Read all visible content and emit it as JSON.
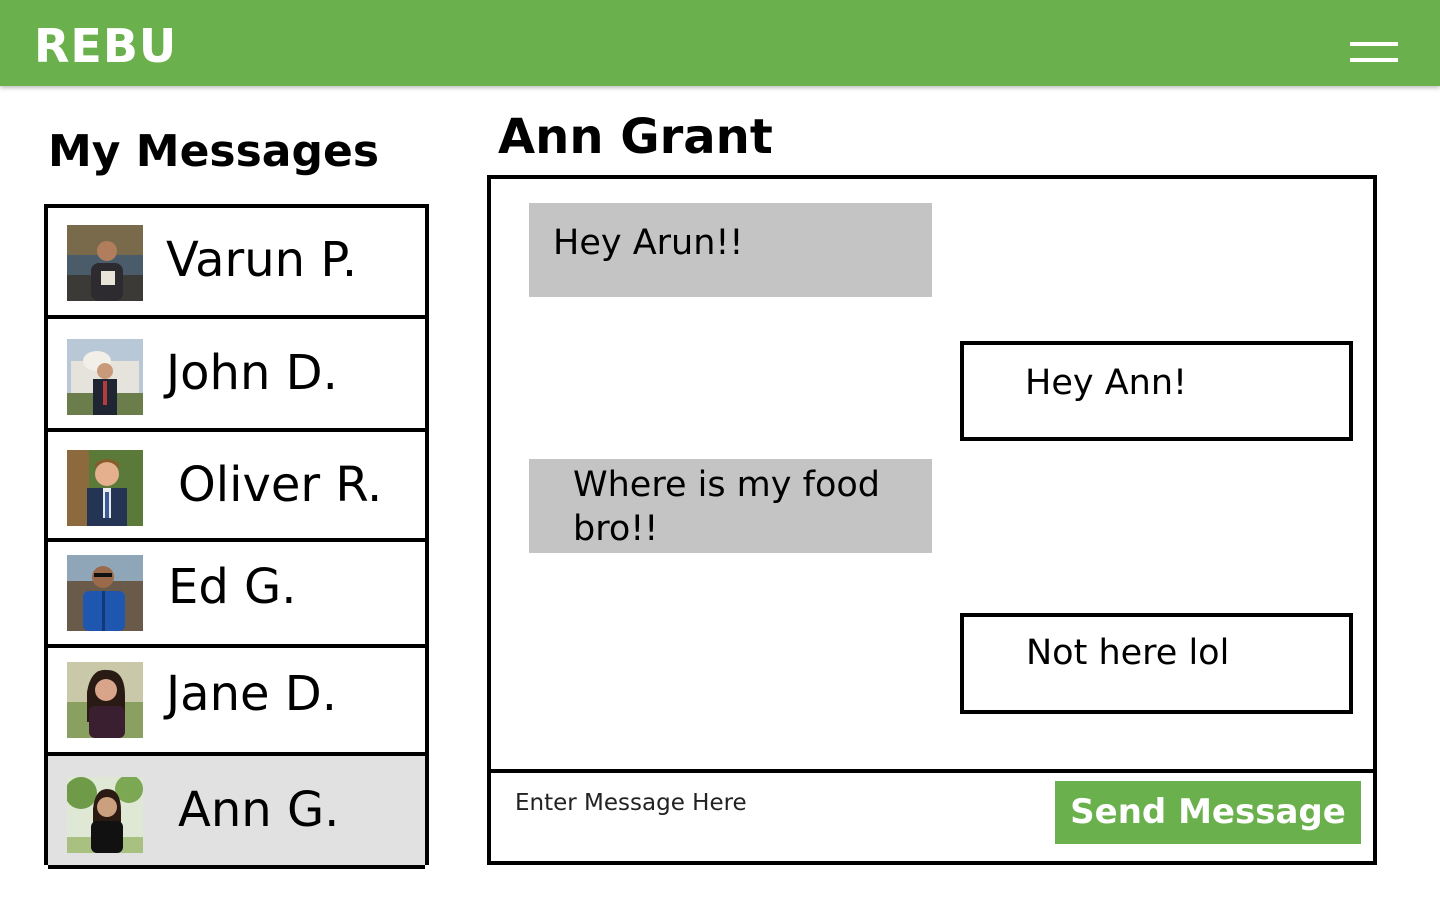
{
  "header": {
    "brand": "REBU",
    "menu_icon": "hamburger-menu-icon",
    "color": "#6ab04c"
  },
  "sidebar": {
    "title": "My Messages",
    "contacts": [
      {
        "name": "Varun P.",
        "active": false
      },
      {
        "name": "John D.",
        "active": false
      },
      {
        "name": "Oliver R.",
        "active": false
      },
      {
        "name": "Ed G.",
        "active": false
      },
      {
        "name": "Jane D.",
        "active": false
      },
      {
        "name": "Ann G.",
        "active": true
      }
    ]
  },
  "chat": {
    "title": "Ann Grant",
    "messages": [
      {
        "from": "them",
        "text": "Hey Arun!!"
      },
      {
        "from": "me",
        "text": "Hey Ann!"
      },
      {
        "from": "them",
        "text": "Where is my food bro!!"
      },
      {
        "from": "me",
        "text": "Not here lol"
      }
    ],
    "input_placeholder": "Enter Message Here",
    "input_value": "",
    "send_label": "Send Message"
  }
}
